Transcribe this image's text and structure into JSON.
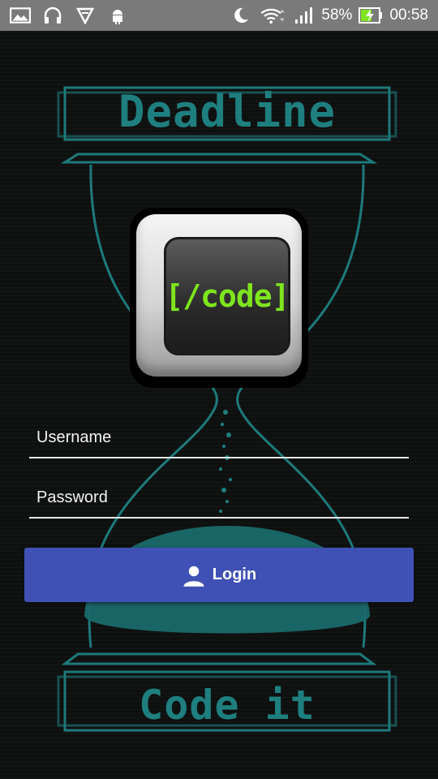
{
  "status_bar": {
    "battery_percent": "58%",
    "time": "00:58",
    "icons": [
      "gallery-icon",
      "headset-icon",
      "vlc-cone-icon",
      "android-icon",
      "moon-icon",
      "wifi-icon",
      "signal-icon",
      "battery-charging-icon"
    ]
  },
  "art": {
    "top_banner": "Deadline",
    "bottom_banner": "Code it",
    "app_icon_text": "[/code]"
  },
  "form": {
    "username_placeholder": "Username",
    "password_placeholder": "Password",
    "login_label": "Login"
  },
  "colors": {
    "accent_teal": "#1f7f7f",
    "button": "#3f51b5",
    "code_green": "#7ee51e"
  }
}
